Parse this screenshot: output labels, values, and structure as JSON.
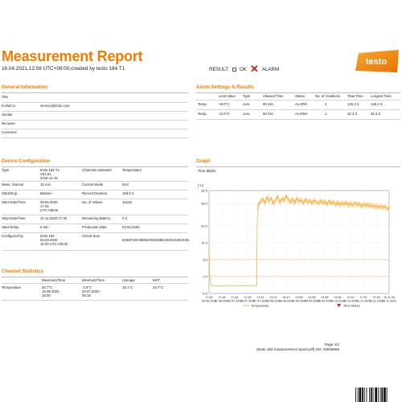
{
  "header": {
    "title": "Measurement Report",
    "subtitle": "16.04.2021,12:56 UTC+08:00,created by testo 184 T1",
    "result_label": "RESULT:",
    "ok_label": "OK",
    "alarm_label": "ALARM",
    "logo_text": "testo",
    "accent_color": "#f07d00",
    "alarm_color": "#d21f1f"
  },
  "general": {
    "heading": "General Information",
    "rows": [
      {
        "label": "Title",
        "value": ""
      },
      {
        "label": "E-Mail to",
        "value": "service@testo.com"
      },
      {
        "label": "Sender",
        "value": ""
      },
      {
        "label": "Receiver",
        "value": ""
      },
      {
        "label": "Comment",
        "value": ""
      }
    ]
  },
  "alarm": {
    "heading": "Alarm Settings & Results",
    "columns": [
      "",
      "Limit Value",
      "Type",
      "Allowed Time",
      "Status",
      "No. of Violations",
      "Total Time",
      "Longest Time"
    ],
    "rows": [
      [
        "Temp.",
        ">8.0°C",
        "cum.",
        "60 min",
        "ALARM",
        "2",
        "125.3 d",
        "125.2 d"
      ],
      [
        "Temp.",
        "<2.0°C",
        "cum.",
        "60 min",
        "ALARM",
        "1",
        "42.3 d",
        "42.3 d"
      ]
    ]
  },
  "device": {
    "heading": "Device Configuration",
    "rows": [
      {
        "l1": "Type",
        "v1": "testo 184 T1\nV01.51\n2018-11-15",
        "l2": "Channels activated",
        "v2": "Temperature"
      },
      {
        "l1": "Meas. Interval",
        "v1": "15 min",
        "l2": "Current Mode",
        "v2": "End"
      },
      {
        "l1": "Start/Stop",
        "v1": "Button/--",
        "l2": "Record Duration",
        "v2": "168.0 d"
      },
      {
        "l1": "Start Date/Time",
        "v1": "09.06.2020\n17:45\nUTC+08:00",
        "l2": "No. of Values",
        "v2": "16128"
      },
      {
        "l1": "Stop Date/Time",
        "v1": "24.11.2020 17:30",
        "l2": "Remaining Battery",
        "v2": "0 d"
      },
      {
        "l1": "Start Delay",
        "v1": "0 min",
        "l2": "Production Date",
        "v2": "03.03.2020"
      },
      {
        "l1": "Configured by",
        "v1": "testo 184\n03.03.2020\n10:20 UTC+08:00",
        "l2": "Check Sum",
        "v2": "\n8AB4F36C9B86C9D8189EAE331325CE36"
      }
    ]
  },
  "channel": {
    "heading": "Channel Statistics",
    "columns": [
      "",
      "Maximum/Time",
      "Minimum/Time",
      "Average",
      "MKT"
    ],
    "rows": [
      [
        "Temperature",
        "30.7°C\n16.08.2020\n15:00",
        "-1.9°C\n20.07.2020\n08:16",
        "19.1°C",
        "23.7°C"
      ]
    ]
  },
  "graph": {
    "heading": "Graph",
    "subheading": "Time Marks",
    "y_unit": "[°C]",
    "legend_temperature": "Temperature",
    "legend_time_marks": "Time Marks"
  },
  "footer": {
    "page": "Page 1/1",
    "file": "(testo 184 measurement report.pdf),SN: 43826969"
  },
  "chart_data": {
    "type": "line",
    "ylabel": "[°C]",
    "ylim": [
      -4.0,
      32.5
    ],
    "yticks": [
      "32.5",
      "28.0",
      "20.0",
      "14.0",
      "8.0",
      "2.0",
      "-4.0"
    ],
    "xticks": [
      {
        "date": "09.06.2020",
        "time": "17:45"
      },
      {
        "date": "21.06.2020",
        "time": "17:44"
      },
      {
        "date": "03.07.2020",
        "time": "17:44"
      },
      {
        "date": "15.07.2020",
        "time": "17:43"
      },
      {
        "date": "27.07.2020",
        "time": "17:42"
      },
      {
        "date": "08.08.2020",
        "time": "21:07"
      },
      {
        "date": "20.08.2020",
        "time": "04:10"
      },
      {
        "date": "02.09.2020",
        "time": "01:59"
      },
      {
        "date": "14.09.2020",
        "time": "01:59"
      },
      {
        "date": "26.09.2020",
        "time": "01:59"
      },
      {
        "date": "08.10.2020",
        "time": "01:59"
      },
      {
        "date": "20.10.2020",
        "time": "13:10"
      },
      {
        "date": "01.11.2020",
        "time": "17:32"
      },
      {
        "date": "13.11.2020",
        "time": "17:30"
      },
      {
        "date": "24.11.2020",
        "time": "10:11:34"
      }
    ],
    "limit_lines": [
      8.0,
      2.0
    ],
    "series": [
      {
        "name": "Temperature",
        "color": "#f5a623",
        "x_days": [
          0,
          0.3,
          1,
          2,
          3,
          6,
          10,
          15,
          20,
          25,
          30,
          35,
          40,
          44.5,
          44.9,
          45.3,
          46,
          48,
          50,
          52,
          54,
          56,
          58,
          60,
          62,
          64,
          66,
          68,
          70,
          72,
          74,
          76,
          78,
          80,
          82,
          84,
          86,
          88,
          90,
          92,
          94,
          96,
          98,
          100,
          102,
          104,
          106,
          108,
          110,
          112,
          114,
          116,
          118,
          120,
          122,
          124,
          126,
          128,
          130,
          132,
          134,
          136,
          138,
          140,
          142,
          144,
          146,
          148,
          150,
          152,
          154,
          156,
          158,
          160,
          162,
          164,
          166,
          168
        ],
        "y": [
          14.0,
          3.0,
          1.0,
          -1.0,
          -1.2,
          -1.3,
          -1.3,
          -1.2,
          -1.3,
          -1.2,
          -1.3,
          -1.3,
          -1.2,
          -1.3,
          18.0,
          26.5,
          27.5,
          28.5,
          29.5,
          28.0,
          30.2,
          28.8,
          29.8,
          27.8,
          29.0,
          30.5,
          28.2,
          29.6,
          28.9,
          30.7,
          29.2,
          28.4,
          29.5,
          28.1,
          29.8,
          28.6,
          29.2,
          28.0,
          29.4,
          28.3,
          29.0,
          27.9,
          29.1,
          28.4,
          27.8,
          28.9,
          28.2,
          28.6,
          27.6,
          28.8,
          27.9,
          28.4,
          27.5,
          28.3,
          27.4,
          28.1,
          27.6,
          28.2,
          27.3,
          27.9,
          27.2,
          28.0,
          27.4,
          27.8,
          26.9,
          27.6,
          27.2,
          27.5,
          26.8,
          27.3,
          26.7,
          27.1,
          26.5,
          27.0,
          26.4,
          26.8,
          26.2,
          26.0
        ]
      }
    ]
  }
}
